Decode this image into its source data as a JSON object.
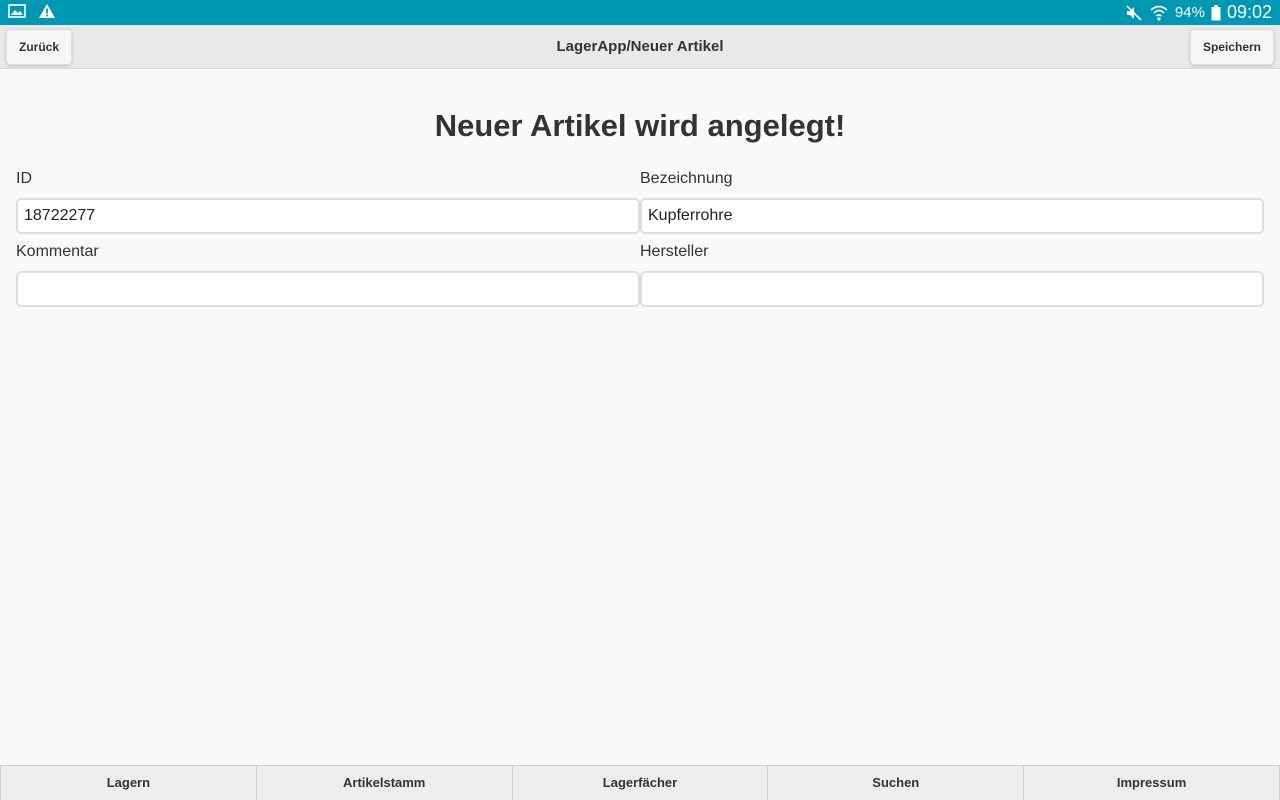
{
  "status_bar": {
    "battery": "94%",
    "time": "09:02"
  },
  "header": {
    "back_label": "Zurück",
    "title": "LagerApp/Neuer Artikel",
    "save_label": "Speichern"
  },
  "page": {
    "heading": "Neuer Artikel wird angelegt!"
  },
  "form": {
    "id": {
      "label": "ID",
      "value": "18722277"
    },
    "bezeichnung": {
      "label": "Bezeichnung",
      "value": "Kupferrohre"
    },
    "kommentar": {
      "label": "Kommentar",
      "value": ""
    },
    "hersteller": {
      "label": "Hersteller",
      "value": ""
    }
  },
  "tabs": [
    {
      "label": "Lagern"
    },
    {
      "label": "Artikelstamm"
    },
    {
      "label": "Lagerfächer"
    },
    {
      "label": "Suchen"
    },
    {
      "label": "Impressum"
    }
  ],
  "colors": {
    "status_bar": "#0097b2",
    "header_bg": "#e9e9e9",
    "page_bg": "#f9f9f9"
  }
}
